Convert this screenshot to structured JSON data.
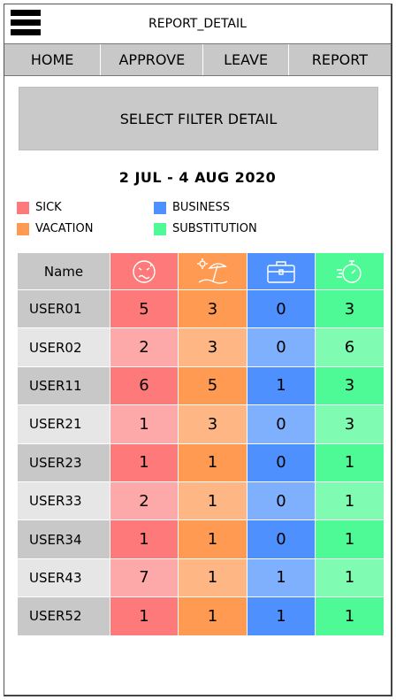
{
  "app": {
    "title": "REPORT_DETAIL"
  },
  "nav": {
    "items": [
      {
        "label": "HOME"
      },
      {
        "label": "APPROVE"
      },
      {
        "label": "LEAVE"
      },
      {
        "label": "REPORT"
      }
    ]
  },
  "filter": {
    "label": "SELECT FILTER DETAIL"
  },
  "date_range": "2 JUL - 4 AUG 2020",
  "legend": {
    "sick": {
      "label": "SICK",
      "color": "#fe7a7a"
    },
    "business": {
      "label": "BUSINESS",
      "color": "#4d90fe"
    },
    "vacation": {
      "label": "VACATION",
      "color": "#fe9a52"
    },
    "substitution": {
      "label": "SUBSTITUTION",
      "color": "#4efa96"
    }
  },
  "table": {
    "name_header": "Name",
    "column_icons": [
      "sick-face-icon",
      "beach-umbrella-icon",
      "briefcase-icon",
      "stopwatch-icon"
    ],
    "colors": {
      "name_dark": "#c8c8c8",
      "name_light": "#e6e6e6",
      "sick_dark": "#fe7a7a",
      "sick_light": "#fda9a9",
      "vacation_dark": "#fe9a52",
      "vacation_light": "#feb685",
      "business_dark": "#4d90fe",
      "business_light": "#7fb0fd",
      "substitution_dark": "#4efa96",
      "substitution_light": "#80fbb2"
    },
    "rows": [
      {
        "name": "USER01",
        "sick": "5",
        "vacation": "3",
        "business": "0",
        "substitution": "3"
      },
      {
        "name": "USER02",
        "sick": "2",
        "vacation": "3",
        "business": "0",
        "substitution": "6"
      },
      {
        "name": "USER11",
        "sick": "6",
        "vacation": "5",
        "business": "1",
        "substitution": "3"
      },
      {
        "name": "USER21",
        "sick": "1",
        "vacation": "3",
        "business": "0",
        "substitution": "3"
      },
      {
        "name": "USER23",
        "sick": "1",
        "vacation": "1",
        "business": "0",
        "substitution": "1"
      },
      {
        "name": "USER33",
        "sick": "2",
        "vacation": "1",
        "business": "0",
        "substitution": "1"
      },
      {
        "name": "USER34",
        "sick": "1",
        "vacation": "1",
        "business": "0",
        "substitution": "1"
      },
      {
        "name": "USER43",
        "sick": "7",
        "vacation": "1",
        "business": "1",
        "substitution": "1"
      },
      {
        "name": "USER52",
        "sick": "1",
        "vacation": "1",
        "business": "1",
        "substitution": "1"
      }
    ]
  }
}
